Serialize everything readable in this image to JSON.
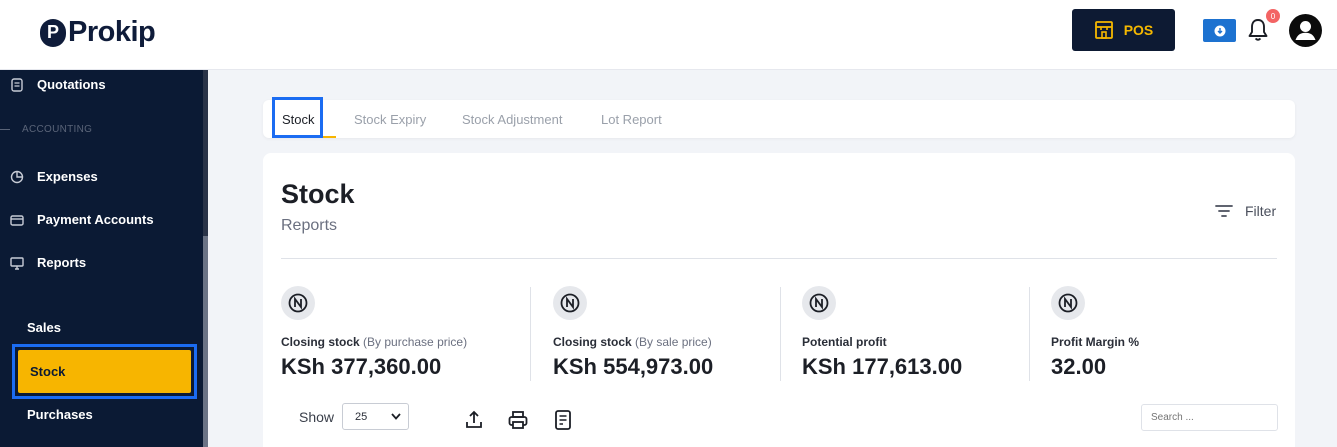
{
  "header": {
    "logo_text": "Prokip",
    "pos_label": "POS",
    "notification_count": "0"
  },
  "sidebar": {
    "quotations": "Quotations",
    "section_accounting": "ACCOUNTING",
    "expenses": "Expenses",
    "payment_accounts": "Payment Accounts",
    "reports": "Reports",
    "sales": "Sales",
    "stock": "Stock",
    "purchases": "Purchases"
  },
  "tabs": [
    "Stock",
    "Stock Expiry",
    "Stock Adjustment",
    "Lot Report"
  ],
  "page": {
    "title": "Stock",
    "subtitle": "Reports",
    "filter_label": "Filter"
  },
  "stats": [
    {
      "label": "Closing stock",
      "note": "(By purchase price)",
      "value": "KSh 377,360.00"
    },
    {
      "label": "Closing stock",
      "note": "(By sale price)",
      "value": "KSh 554,973.00"
    },
    {
      "label": "Potential profit",
      "note": "",
      "value": "KSh 177,613.00"
    },
    {
      "label": "Profit Margin %",
      "note": "",
      "value": "32.00"
    }
  ],
  "table_controls": {
    "show_label": "Show",
    "page_size": "25",
    "search_placeholder": "Search ..."
  },
  "colors": {
    "accent": "#f7b500",
    "navy": "#0b1a34",
    "highlight": "#1b6cf2"
  }
}
